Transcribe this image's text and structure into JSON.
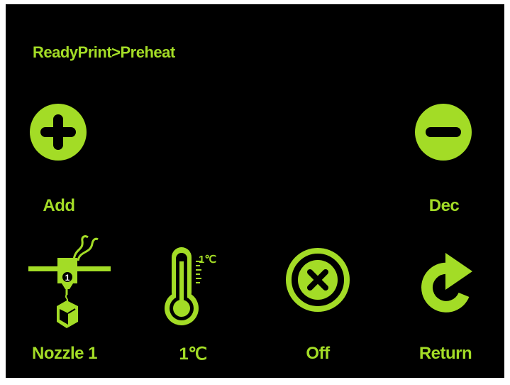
{
  "screen": {
    "breadcrumb": "ReadyPrint>Preheat",
    "accent_color": "#a3dc26",
    "background_color": "#000000"
  },
  "buttons": {
    "add": {
      "label": "Add",
      "icon": "plus-circle-icon"
    },
    "dec": {
      "label": "Dec",
      "icon": "minus-circle-icon"
    },
    "nozzle": {
      "label": "Nozzle 1",
      "icon": "nozzle-extruder-icon",
      "badge": "1"
    },
    "temperature": {
      "label": "1℃",
      "icon": "thermometer-icon",
      "step_label": "1℃"
    },
    "off": {
      "label": "Off",
      "icon": "close-circle-icon"
    },
    "return": {
      "label": "Return",
      "icon": "return-arrow-icon"
    }
  }
}
